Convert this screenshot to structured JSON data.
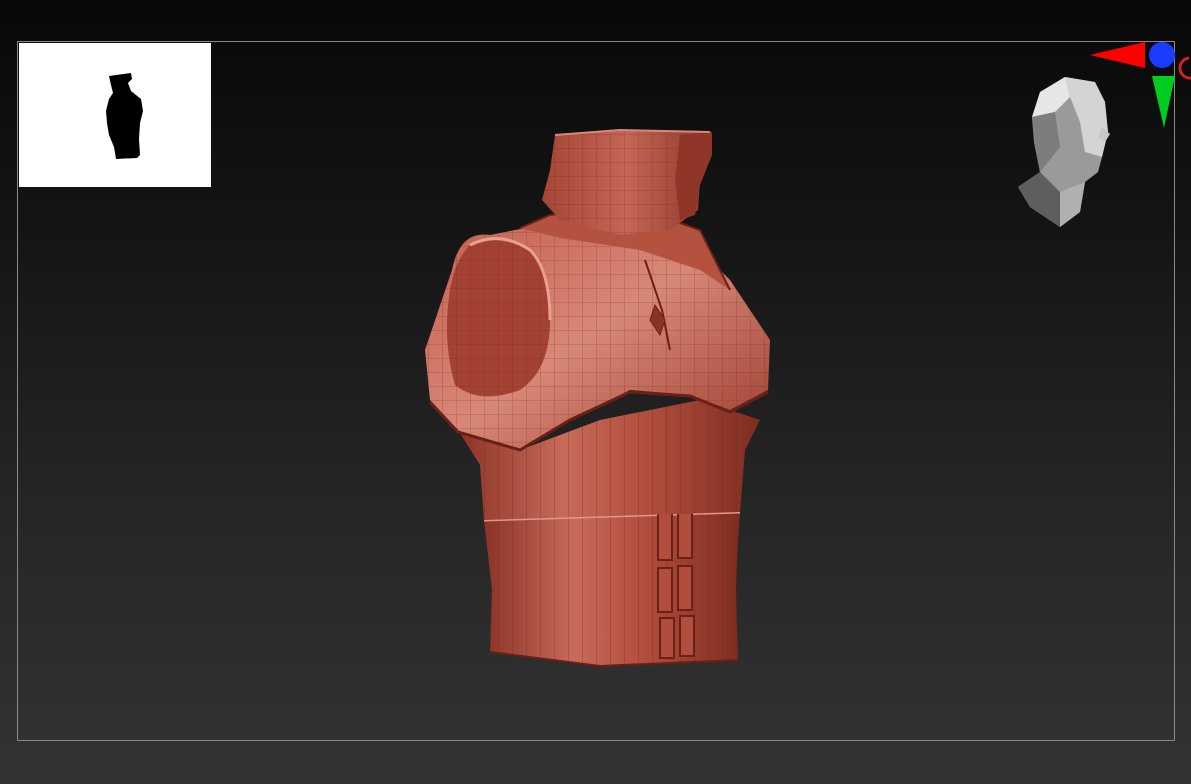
{
  "app": {
    "mode": "3d-sculpt-viewport"
  },
  "viewport": {
    "background_top": "#080808",
    "background_bottom": "#333333",
    "frame_border": "#8a8a8a"
  },
  "navigator": {
    "icon": "mesh-silhouette-thumbnail"
  },
  "model": {
    "icon": "armored-vest-mesh",
    "material_color": "#b4503f"
  },
  "gizmo": {
    "x_axis_color": "#ff0000",
    "y_axis_color": "#00cc22",
    "z_axis_color": "#1a3cff",
    "icon": "axis-gizmo-icon"
  },
  "orientation_head": {
    "icon": "view-orientation-head-icon"
  }
}
